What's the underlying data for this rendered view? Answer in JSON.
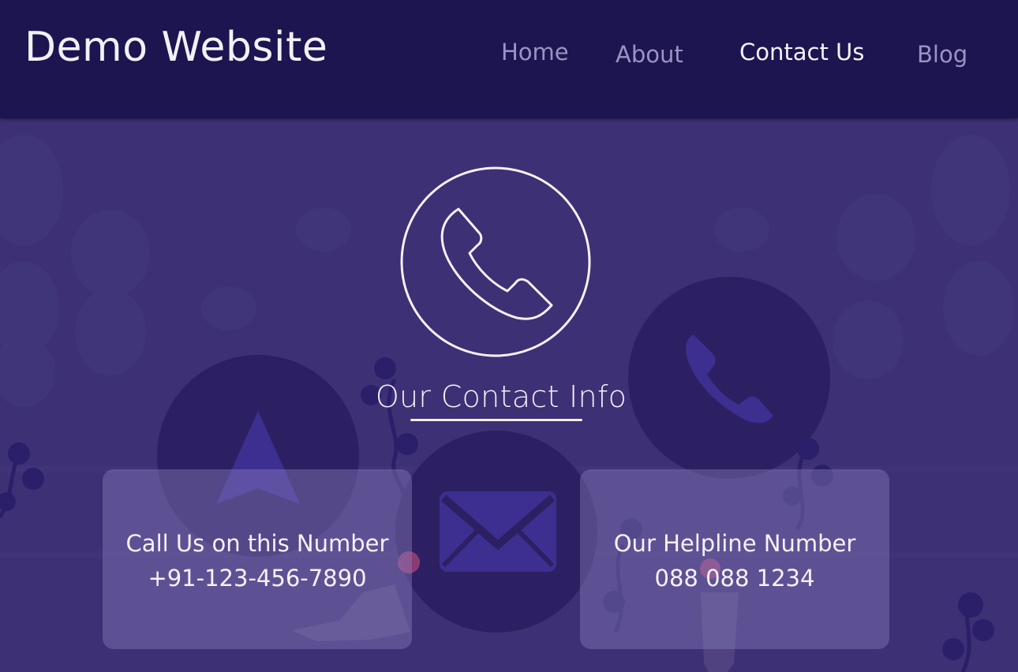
{
  "header": {
    "brand": "Demo Website",
    "nav": [
      {
        "label": "Home",
        "active": false
      },
      {
        "label": "About",
        "active": false
      },
      {
        "label": "Contact Us",
        "active": true
      },
      {
        "label": "Blog",
        "active": false
      }
    ]
  },
  "main": {
    "title": "Our Contact Info",
    "cards": [
      {
        "heading": "Call Us on this Number",
        "value": "+91-123-456-7890"
      },
      {
        "heading": "Our Helpline Number",
        "value": "088 088 1234"
      }
    ],
    "icons": [
      "phone-icon",
      "navigation-arrow-icon",
      "mail-icon"
    ]
  },
  "colors": {
    "header_bg": "#1d1550",
    "page_bg": "#3d3074",
    "text_light": "#f2f0f8",
    "nav_inactive": "#9b93c4",
    "decor_circle": "#2c2063"
  }
}
